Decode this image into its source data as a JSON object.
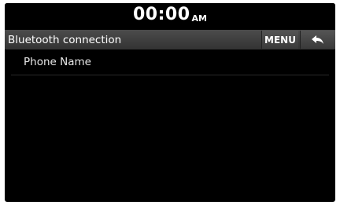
{
  "status_bar": {
    "time": "00:00",
    "ampm": "AM"
  },
  "header": {
    "title": "Bluetooth connection",
    "menu_label": "MENU",
    "back_icon": "back-arrow-icon"
  },
  "list": {
    "items": [
      {
        "label": "Phone Name"
      }
    ]
  }
}
